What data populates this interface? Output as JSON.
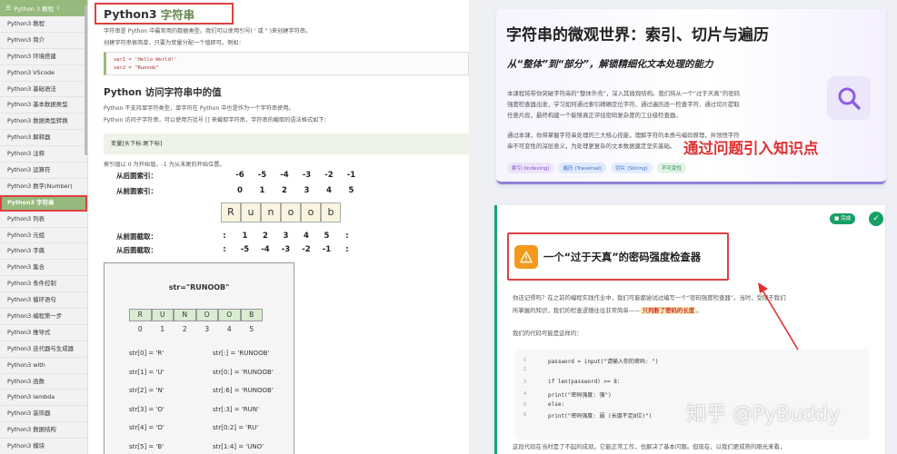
{
  "sidebar": {
    "header": "Python 3 教程",
    "items": [
      "Python3 教程",
      "Python3 简介",
      "Python3 环境搭建",
      "Python3 VScode",
      "Python3 基础语法",
      "Python3 基本数据类型",
      "Python3 数据类型转换",
      "Python3 解释器",
      "Python3 注释",
      "Python3 运算符",
      "Python3 数字(Number)",
      "Python3 字符串",
      "Python3 列表",
      "Python3 元组",
      "Python3 字典",
      "Python3 集合",
      "Python3 条件控制",
      "Python3 循环语句",
      "Python3 编程第一步",
      "Python3 推导式",
      "Python3 迭代器与生成器",
      "Python3 with",
      "Python3 函数",
      "Python3 lambda",
      "Python3 装饰器",
      "Python3 数据结构",
      "Python3 模块"
    ],
    "active_index": 11
  },
  "article": {
    "title_prefix": "Python3",
    "title_highlight": "字符串",
    "intro1": "字符串是 Python 中最常用的数据类型。我们可以使用引号( ' 或 \" )来创建字符串。",
    "intro2": "创建字符串很简单，只要为变量分配一个值即可。例如：",
    "code1_line1": "var1 = 'Hello World!'",
    "code1_line2": "var2 = \"Runoob\"",
    "section2": "Python 访问字符串中的值",
    "p1": "Python 不支持单字符类型，单字符在 Python 中也是作为一个字符串使用。",
    "p2": "Python 访问子字符串，可以使用方括号 [] 来截取字符串，字符串的截取的语法格式如下：",
    "syntax": "变量[头下标:尾下标]",
    "p3": "索引值以 0 为开始值，-1 为从末尾的开始位置。",
    "label_back": "从后面索引：",
    "label_front": "从前面索引：",
    "label_front_slice": "从前面截取：",
    "label_back_slice": "从后面截取：",
    "back_index": [
      "-6",
      "-5",
      "-4",
      "-3",
      "-2",
      "-1"
    ],
    "front_index": [
      "0",
      "1",
      "2",
      "3",
      "4",
      "5"
    ],
    "letters": [
      "R",
      "u",
      "n",
      "o",
      "o",
      "b"
    ],
    "front_slice": [
      ":",
      "1",
      "2",
      "3",
      "4",
      "5",
      ":"
    ],
    "back_slice": [
      ":",
      "-5",
      "-4",
      "-3",
      "-2",
      "-1",
      ":"
    ]
  },
  "diagram": {
    "title": "str=\"RUNOOB\"",
    "letters": [
      "R",
      "U",
      "N",
      "O",
      "O",
      "B"
    ],
    "indices": [
      "0",
      "1",
      "2",
      "3",
      "4",
      "5"
    ],
    "left_lines": [
      "str[0] = 'R'",
      "str[1] = 'U'",
      "str[2] = 'N'",
      "str[3] = 'O'",
      "str[4] = 'O'",
      "str[5] = 'B'"
    ],
    "right_lines": [
      "str[:] = 'RUNOOB'",
      "str[0:] = 'RUNOOB'",
      "str[:6] = 'RUNOOB'",
      "str[:3] = 'RUN'",
      "str[0:2] = 'RU'",
      "str[1:4] = 'UNO'"
    ]
  },
  "card1": {
    "title": "字符串的微观世界：索引、切片与遍历",
    "subtitle": "从“整体”到“部分”，解锁精细化文本处理的能力",
    "p1_l1": "本课程将带你突破字符串的“整体外壳”，深入其微观结构。我们将从一个“过于天真”的密码",
    "p1_l2": "强度检查器出发，学习如何通过索引精确定位字符、通过遍历逐一检查字符、通过切片提取",
    "p1_l3": "任意片段，最终构建一个能够真正评估密码复杂度的工业级检查器。",
    "p2_l1": "通过本课，你将掌握字符串处理的三大核心技能，理解字符的本质与编码原理，并领悟字符",
    "p2_l2": "串不可变性的深层意义，为处理更复杂的文本数据奠定坚实基础。",
    "tags": [
      "索引 (Indexing)",
      "遍历 (Traversal)",
      "切片 (Slicing)",
      "不可变性"
    ],
    "tag_colors": [
      "#ede4fb",
      "#dfeafb",
      "#e2edfd",
      "#e1f5e6"
    ],
    "tag_text_colors": [
      "#7a4fc9",
      "#3a6bc8",
      "#3a6bc8",
      "#2a8a4a"
    ]
  },
  "card2": {
    "done_label": "完成",
    "title": "一个“过于天真”的密码强度检查器",
    "p1_l1": "你还记得吗？在之前的编程实践作业中，我们可能都尝试过编写一个“密码强度检查器”。当时，受限于我们",
    "p1_l2_pre": "所掌握的知识，我们的检查逻辑往往非常简单——",
    "p1_l2_mark": "只判断了密码的长度",
    "p1_l2_post": "。",
    "p2": "我们的代码可能是这样的：",
    "code_lines": [
      "password = input(\"请输入你的密码: \")",
      "",
      "if len(password) >= 8:",
      "    print(\"密码强度: 强\")",
      "else:",
      "    print(\"密码强度: 弱 (长度不足8位)\")"
    ],
    "line_numbers": [
      "1",
      "2",
      "3",
      "4",
      "5",
      "6"
    ],
    "p3": "这段代码在当时是了不起的成就，它能正常工作，也解决了基本问题。但现在，以我们更成熟的眼光来看，"
  },
  "annotation": "通过问题引入知识点",
  "watermark": "知乎 @PyBuddy"
}
